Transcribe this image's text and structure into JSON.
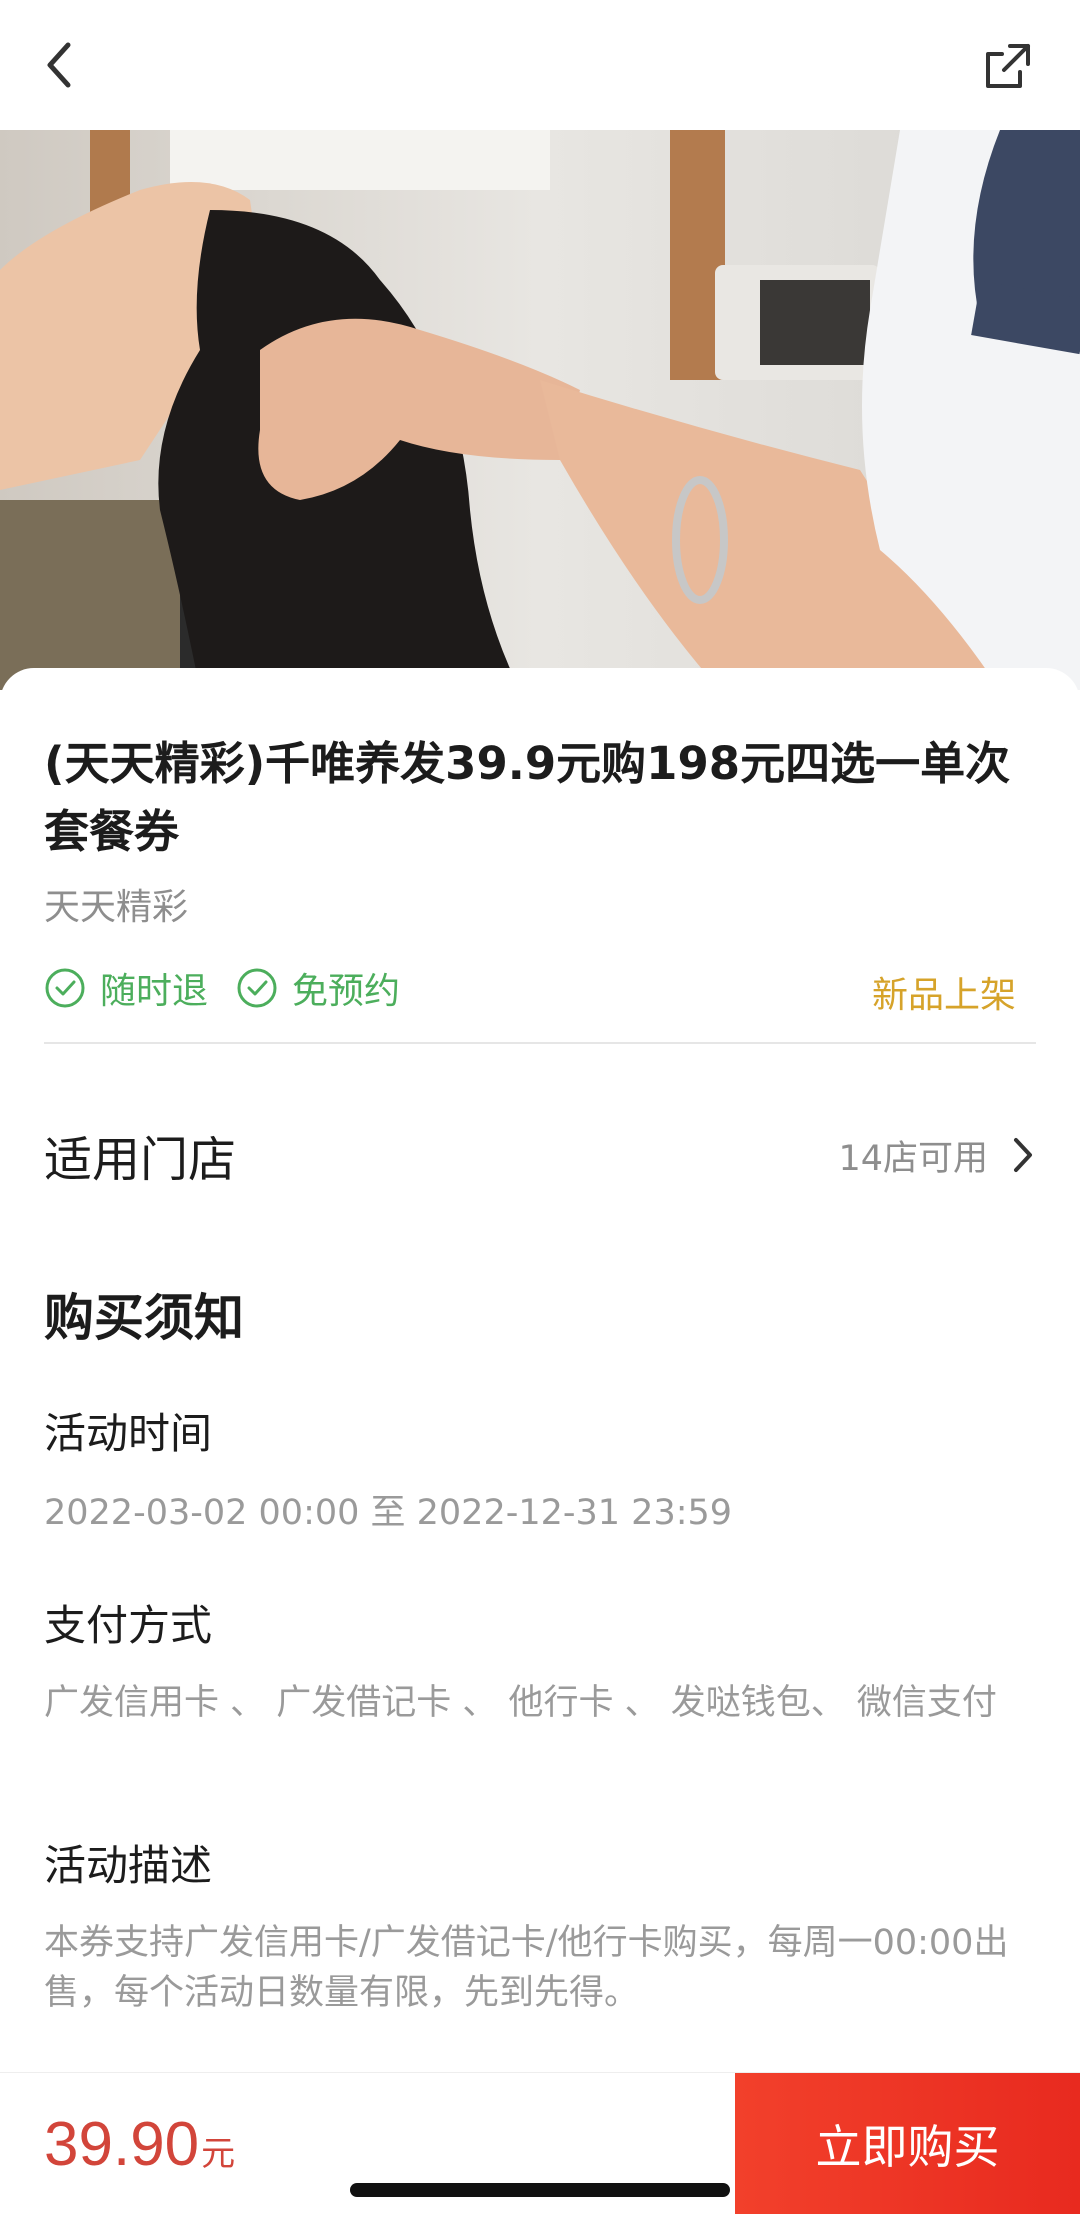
{
  "nav": {
    "back_icon": "chevron-left-icon",
    "share_icon": "share-external-icon"
  },
  "hero": {
    "description_icon": "scalp-massage-photo"
  },
  "product": {
    "title": "(天天精彩)千唯养发39.9元购198元四选一单次套餐券",
    "subtitle": "天天精彩",
    "tags": [
      {
        "label": "随时退",
        "icon": "check-circle-icon"
      },
      {
        "label": "免预约",
        "icon": "check-circle-icon"
      }
    ],
    "badge": "新品上架",
    "tag_color": "#4cae5c",
    "badge_color": "#d6a32a"
  },
  "stores": {
    "title": "适用门店",
    "count": "14店可用",
    "icon": "chevron-right-icon"
  },
  "notice": {
    "title": "购买须知",
    "items": [
      {
        "label": "活动时间",
        "text": "2022-03-02 00:00 至 2022-12-31 23:59"
      },
      {
        "label": "支付方式",
        "text": "广发信用卡 、 广发借记卡 、 他行卡 、 发哒钱包、 微信支付"
      },
      {
        "label": "活动描述",
        "text": "本券支持广发信用卡/广发借记卡/他行卡购买，每周一00:00出售，每个活动日数量有限，先到先得。"
      }
    ]
  },
  "footer": {
    "price": "39.90",
    "unit": "元",
    "buy_label": "立即购买",
    "price_color": "#d2453a",
    "buy_color": "#f2402b"
  }
}
